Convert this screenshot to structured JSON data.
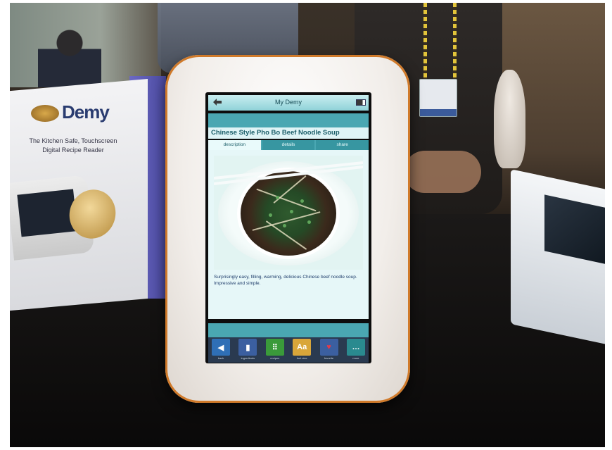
{
  "box": {
    "logo": "Demy",
    "tagline": "The Kitchen Safe, Touchscreen Digital Recipe Reader"
  },
  "device": {
    "title": "My Demy",
    "recipe_title": "Chinese Style Pho Bo Beef Noodle Soup",
    "tabs": [
      {
        "label": "description",
        "active": true
      },
      {
        "label": "details",
        "active": false
      },
      {
        "label": "share",
        "active": false
      }
    ],
    "description": "Surprisingly easy, filling, warming, delicious Chinese beef noodle soup. Impressive and simple.",
    "toolbar": [
      {
        "icon": "back-arrow-icon",
        "color": "#2f6fb6",
        "glyph": "◀",
        "label": "back"
      },
      {
        "icon": "ingredients-icon",
        "color": "#3b5fa0",
        "glyph": "▮",
        "label": "ingredients"
      },
      {
        "icon": "grid-icon",
        "color": "#3a9a3a",
        "glyph": "⠿",
        "label": "recipes"
      },
      {
        "icon": "font-size-icon",
        "color": "#d9a63a",
        "glyph": "Aa",
        "label": "font size"
      },
      {
        "icon": "heart-icon",
        "color": "#3b5fa0",
        "glyph": "♥",
        "label": "favorite"
      },
      {
        "icon": "more-icon",
        "color": "#2a8a8f",
        "glyph": "…",
        "label": "more"
      }
    ]
  }
}
